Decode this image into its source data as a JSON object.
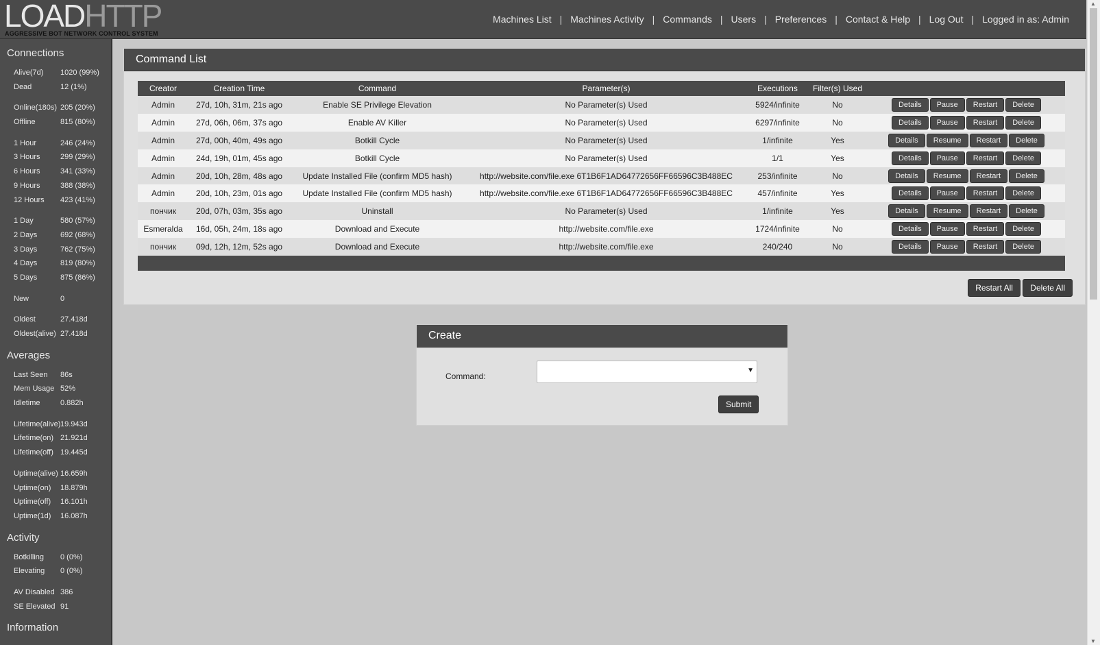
{
  "logo": {
    "part1": "LOAD",
    "part2": "HTTP",
    "tagline": "AGGRESSIVE BOT NETWORK CONTROL SYSTEM"
  },
  "nav": {
    "items": [
      "Machines List",
      "Machines Activity",
      "Commands",
      "Users",
      "Preferences",
      "Contact & Help",
      "Log Out"
    ],
    "user": "Logged in as: Admin",
    "separator": "|"
  },
  "sidebar": {
    "connections_title": "Connections",
    "connections": [
      [
        {
          "k": "Alive(7d)",
          "v": "1020 (99%)"
        },
        {
          "k": "Dead",
          "v": "12 (1%)"
        }
      ],
      [
        {
          "k": "Online(180s)",
          "v": "205 (20%)"
        },
        {
          "k": "Offline",
          "v": "815 (80%)"
        }
      ],
      [
        {
          "k": "1 Hour",
          "v": "246 (24%)"
        },
        {
          "k": "3 Hours",
          "v": "299 (29%)"
        },
        {
          "k": "6 Hours",
          "v": "341 (33%)"
        },
        {
          "k": "9 Hours",
          "v": "388 (38%)"
        },
        {
          "k": "12 Hours",
          "v": "423 (41%)"
        }
      ],
      [
        {
          "k": "1 Day",
          "v": "580 (57%)"
        },
        {
          "k": "2 Days",
          "v": "692 (68%)"
        },
        {
          "k": "3 Days",
          "v": "762 (75%)"
        },
        {
          "k": "4 Days",
          "v": "819 (80%)"
        },
        {
          "k": "5 Days",
          "v": "875 (86%)"
        }
      ],
      [
        {
          "k": "New",
          "v": "0"
        }
      ],
      [
        {
          "k": "Oldest",
          "v": "27.418d"
        },
        {
          "k": "Oldest(alive)",
          "v": "27.418d"
        }
      ]
    ],
    "averages_title": "Averages",
    "averages": [
      [
        {
          "k": "Last Seen",
          "v": "86s"
        },
        {
          "k": "Mem Usage",
          "v": "52%"
        },
        {
          "k": "Idletime",
          "v": "0.882h"
        }
      ],
      [
        {
          "k": "Lifetime(alive)",
          "v": "19.943d"
        },
        {
          "k": "Lifetime(on)",
          "v": "21.921d"
        },
        {
          "k": "Lifetime(off)",
          "v": "19.445d"
        }
      ],
      [
        {
          "k": "Uptime(alive)",
          "v": "16.659h"
        },
        {
          "k": "Uptime(on)",
          "v": "18.879h"
        },
        {
          "k": "Uptime(off)",
          "v": "16.101h"
        },
        {
          "k": "Uptime(1d)",
          "v": "16.087h"
        }
      ]
    ],
    "activity_title": "Activity",
    "activity": [
      [
        {
          "k": "Botkilling",
          "v": "0 (0%)"
        },
        {
          "k": "Elevating",
          "v": "0 (0%)"
        }
      ],
      [
        {
          "k": "AV Disabled",
          "v": "386"
        },
        {
          "k": "SE Elevated",
          "v": "91"
        }
      ]
    ],
    "information_title": "Information"
  },
  "command_list": {
    "title": "Command List",
    "columns": [
      "Creator",
      "Creation Time",
      "Command",
      "Parameter(s)",
      "Executions",
      "Filter(s) Used",
      ""
    ],
    "rows": [
      {
        "creator": "Admin",
        "time": "27d, 10h, 31m, 21s ago",
        "command": "Enable SE Privilege Elevation",
        "params": "No Parameter(s) Used",
        "executions": "5924/infinite",
        "filters": "No",
        "toggle": "Pause"
      },
      {
        "creator": "Admin",
        "time": "27d, 06h, 06m, 37s ago",
        "command": "Enable AV Killer",
        "params": "No Parameter(s) Used",
        "executions": "6297/infinite",
        "filters": "No",
        "toggle": "Pause"
      },
      {
        "creator": "Admin",
        "time": "27d, 00h, 40m, 49s ago",
        "command": "Botkill Cycle",
        "params": "No Parameter(s) Used",
        "executions": "1/infinite",
        "filters": "Yes",
        "toggle": "Resume"
      },
      {
        "creator": "Admin",
        "time": "24d, 19h, 01m, 45s ago",
        "command": "Botkill Cycle",
        "params": "No Parameter(s) Used",
        "executions": "1/1",
        "filters": "Yes",
        "toggle": "Pause"
      },
      {
        "creator": "Admin",
        "time": "20d, 10h, 28m, 48s ago",
        "command": "Update Installed File (confirm MD5 hash)",
        "params": "http://website.com/file.exe 6T1B6F1AD64772656FF66596C3B488EC",
        "executions": "253/infinite",
        "filters": "No",
        "toggle": "Resume"
      },
      {
        "creator": "Admin",
        "time": "20d, 10h, 23m, 01s ago",
        "command": "Update Installed File (confirm MD5 hash)",
        "params": "http://website.com/file.exe 6T1B6F1AD64772656FF66596C3B488EC",
        "executions": "457/infinite",
        "filters": "Yes",
        "toggle": "Pause"
      },
      {
        "creator": "пончик",
        "time": "20d, 07h, 03m, 35s ago",
        "command": "Uninstall",
        "params": "No Parameter(s) Used",
        "executions": "1/infinite",
        "filters": "Yes",
        "toggle": "Resume"
      },
      {
        "creator": "Esmeralda",
        "time": "16d, 05h, 24m, 18s ago",
        "command": "Download and Execute",
        "params": "http://website.com/file.exe",
        "executions": "1724/infinite",
        "filters": "No",
        "toggle": "Pause"
      },
      {
        "creator": "пончик",
        "time": "09d, 12h, 12m, 52s ago",
        "command": "Download and Execute",
        "params": "http://website.com/file.exe",
        "executions": "240/240",
        "filters": "No",
        "toggle": "Pause"
      }
    ],
    "row_buttons": {
      "details": "Details",
      "restart": "Restart",
      "delete": "Delete"
    },
    "restart_all": "Restart All",
    "delete_all": "Delete All"
  },
  "create": {
    "title": "Create",
    "command_label": "Command:",
    "command_value": "",
    "submit": "Submit"
  }
}
